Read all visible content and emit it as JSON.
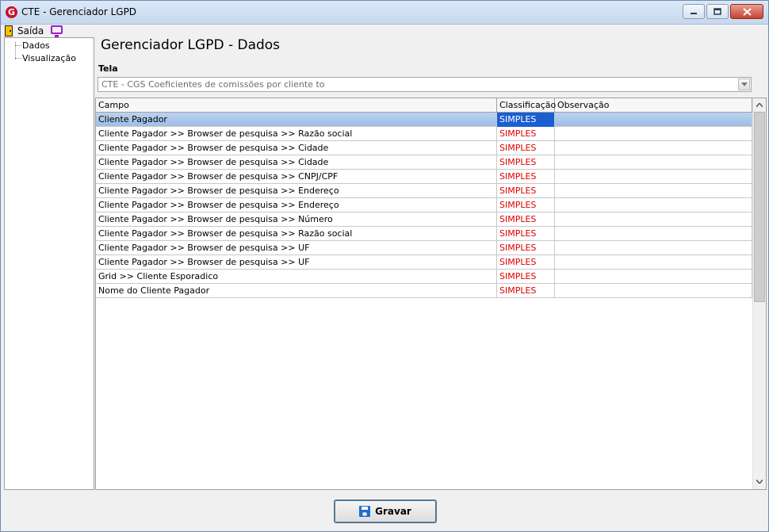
{
  "window": {
    "title": "CTE - Gerenciador LGPD",
    "app_icon": "G"
  },
  "menu": {
    "exit_label": "Saída"
  },
  "tree": {
    "items": [
      {
        "label": "Dados"
      },
      {
        "label": "Visualização"
      }
    ]
  },
  "page": {
    "title": "Gerenciador LGPD - Dados"
  },
  "tela": {
    "label": "Tela",
    "value": "CTE - CGS Coeficientes de comissões por cliente to"
  },
  "grid": {
    "columns": [
      "Campo",
      "Classificação",
      "Observação"
    ],
    "rows": [
      {
        "campo": "Cliente Pagador",
        "classificacao": "SIMPLES",
        "observacao": "",
        "selected": true
      },
      {
        "campo": "Cliente Pagador >> Browser de pesquisa >>  Razão social",
        "classificacao": "SIMPLES",
        "observacao": ""
      },
      {
        "campo": "Cliente Pagador >> Browser de pesquisa >> Cidade",
        "classificacao": "SIMPLES",
        "observacao": ""
      },
      {
        "campo": "Cliente Pagador >> Browser de pesquisa >> Cidade",
        "classificacao": "SIMPLES",
        "observacao": ""
      },
      {
        "campo": "Cliente Pagador >> Browser de pesquisa >> CNPJ/CPF",
        "classificacao": "SIMPLES",
        "observacao": ""
      },
      {
        "campo": "Cliente Pagador >> Browser de pesquisa >> Endereço",
        "classificacao": "SIMPLES",
        "observacao": ""
      },
      {
        "campo": "Cliente Pagador >> Browser de pesquisa >> Endereço",
        "classificacao": "SIMPLES",
        "observacao": ""
      },
      {
        "campo": "Cliente Pagador >> Browser de pesquisa >> Número",
        "classificacao": "SIMPLES",
        "observacao": ""
      },
      {
        "campo": "Cliente Pagador >> Browser de pesquisa >> Razão social",
        "classificacao": "SIMPLES",
        "observacao": ""
      },
      {
        "campo": "Cliente Pagador >> Browser de pesquisa >> UF",
        "classificacao": "SIMPLES",
        "observacao": ""
      },
      {
        "campo": "Cliente Pagador >> Browser de pesquisa >> UF",
        "classificacao": "SIMPLES",
        "observacao": ""
      },
      {
        "campo": "Grid >> Cliente Esporadico",
        "classificacao": "SIMPLES",
        "observacao": ""
      },
      {
        "campo": "Nome do Cliente Pagador",
        "classificacao": "SIMPLES",
        "observacao": ""
      }
    ]
  },
  "footer": {
    "save_label": "Gravar"
  },
  "colors": {
    "classification_text": "#e00000",
    "selected_row": "#9fbde6",
    "selected_cell": "#1a5fd0"
  }
}
